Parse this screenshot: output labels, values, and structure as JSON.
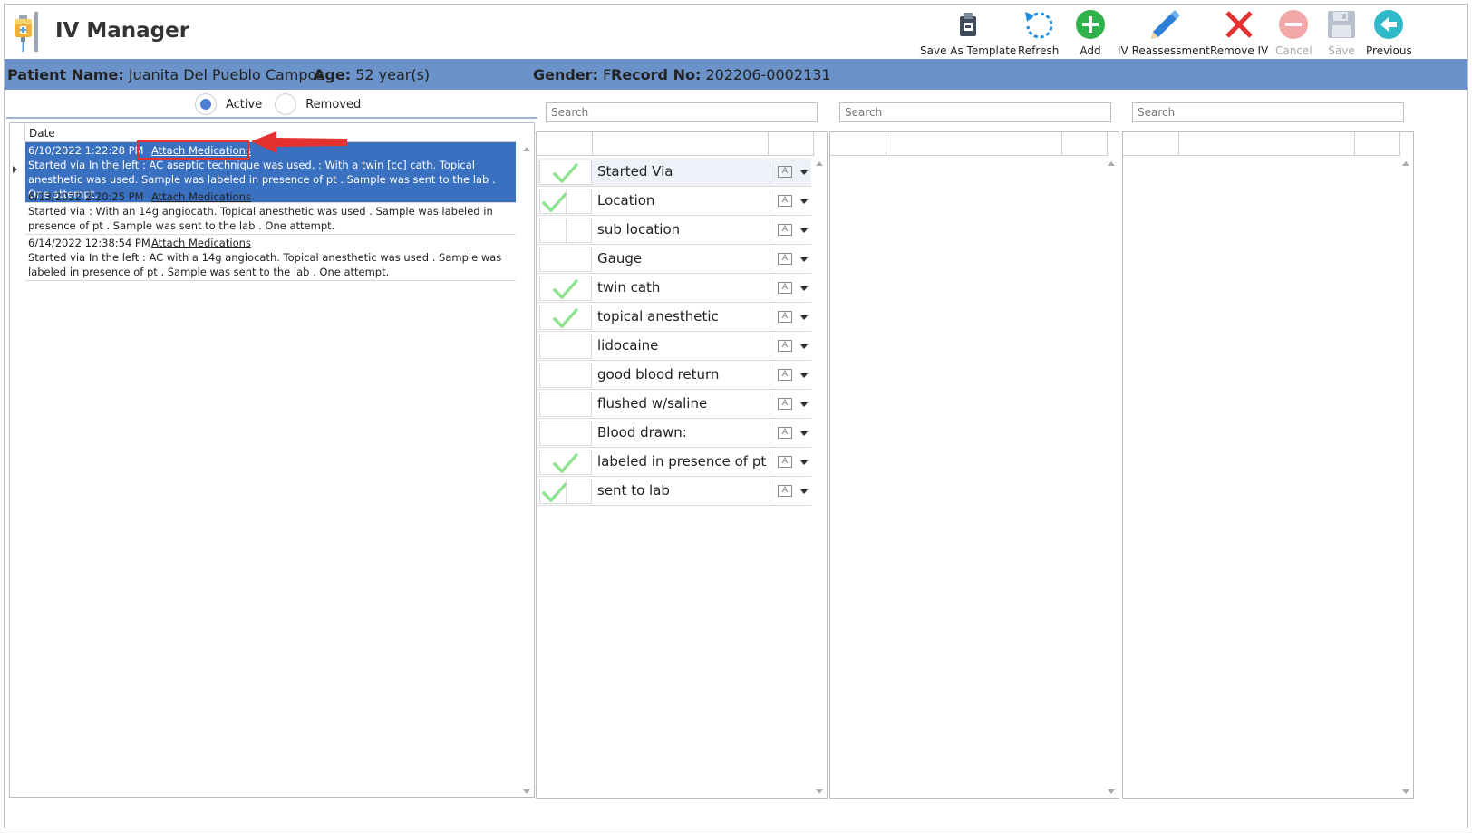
{
  "app": {
    "title": "IV Manager"
  },
  "toolbar": [
    {
      "label": "Save As Template",
      "icon": "save-template-icon",
      "enabled": true
    },
    {
      "label": "Refresh",
      "icon": "refresh-icon",
      "enabled": true
    },
    {
      "label": "Add",
      "icon": "add-icon",
      "enabled": true
    },
    {
      "label": "IV Reassessment",
      "icon": "pencil-icon",
      "enabled": true
    },
    {
      "label": "Remove IV",
      "icon": "remove-icon",
      "enabled": true
    },
    {
      "label": "Cancel",
      "icon": "cancel-icon",
      "enabled": false
    },
    {
      "label": "Save",
      "icon": "floppy-icon",
      "enabled": false
    },
    {
      "label": "Previous",
      "icon": "arrow-left-icon",
      "enabled": true
    }
  ],
  "patient": {
    "name_label": "Patient Name:",
    "name": "Juanita Del Pueblo Campos",
    "age_label": "Age:",
    "age": "52 year(s)",
    "gender_label": "Gender:",
    "gender": "F",
    "record_label": "Record No:",
    "record": "202206-0002131"
  },
  "filter": {
    "active_label": "Active",
    "removed_label": "Removed",
    "selected": "Active"
  },
  "history": {
    "date_header": "Date",
    "entries": [
      {
        "date": "6/10/2022 1:22:28 PM",
        "link": "Attach Medications",
        "text": "Started via In the left : AC aseptic technique was used. : With a twin [cc] cath. Topical anesthetic was used. Sample was labeled in presence of pt . Sample was sent to the lab . One attempt.",
        "selected": true
      },
      {
        "date": "6/13/2022 2:20:25 PM",
        "link": "Attach Medications",
        "text": "Started via : With an 14g angiocath. Topical anesthetic was used . Sample was labeled in presence of pt . Sample was sent to the lab . One attempt.",
        "selected": false
      },
      {
        "date": "6/14/2022 12:38:54 PM",
        "link": "Attach Medications",
        "text": "Started via In the left : AC with a 14g angiocath. Topical anesthetic was used . Sample was labeled in presence of pt . Sample was sent to the lab . One attempt.",
        "selected": false
      }
    ]
  },
  "search": {
    "placeholder": "Search"
  },
  "checklist": [
    {
      "label": "Started Via",
      "checked": true,
      "split": false
    },
    {
      "label": "Location",
      "checked": true,
      "split": true
    },
    {
      "label": "sub location",
      "checked": false,
      "split": true
    },
    {
      "label": "Gauge",
      "checked": false,
      "split": false
    },
    {
      "label": "twin cath",
      "checked": true,
      "split": false
    },
    {
      "label": "topical anesthetic",
      "checked": true,
      "split": false
    },
    {
      "label": "lidocaine",
      "checked": false,
      "split": false
    },
    {
      "label": "good blood return",
      "checked": false,
      "split": false
    },
    {
      "label": "flushed w/saline",
      "checked": false,
      "split": false
    },
    {
      "label": "Blood drawn:",
      "checked": false,
      "split": false
    },
    {
      "label": "labeled in presence of pt",
      "checked": true,
      "split": false
    },
    {
      "label": "sent to lab",
      "checked": true,
      "split": true
    }
  ],
  "colors": {
    "header_bar": "#6c93c9",
    "selected_row": "#3a70c0",
    "check": "#8fe28f",
    "annotation": "#e03030"
  }
}
